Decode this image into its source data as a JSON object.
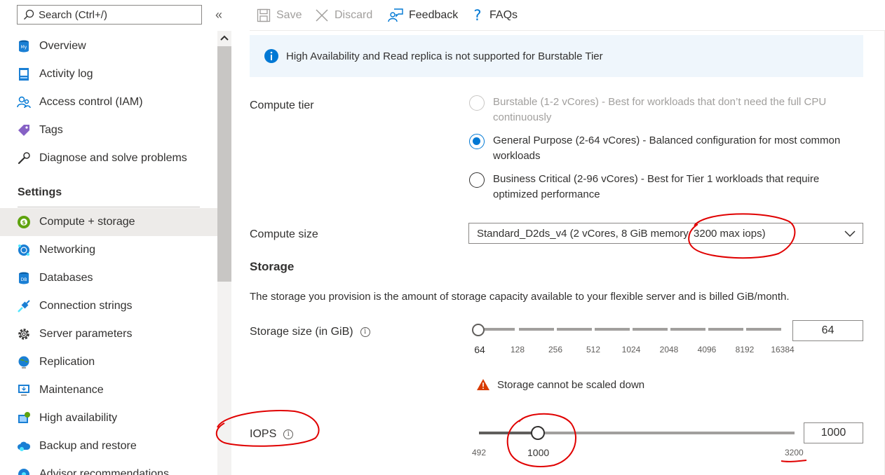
{
  "sidebar": {
    "search_placeholder": "Search (Ctrl+/)",
    "collapse_label": "«",
    "items_top": [
      {
        "label": "Overview",
        "icon": "mysql-database-icon"
      },
      {
        "label": "Activity log",
        "icon": "activity-log-icon"
      },
      {
        "label": "Access control (IAM)",
        "icon": "people-icon"
      },
      {
        "label": "Tags",
        "icon": "tag-icon"
      },
      {
        "label": "Diagnose and solve problems",
        "icon": "wrench-icon"
      }
    ],
    "settings_header": "Settings",
    "items_settings": [
      {
        "label": "Compute + storage",
        "icon": "compute-storage-icon"
      },
      {
        "label": "Networking",
        "icon": "network-globe-icon"
      },
      {
        "label": "Databases",
        "icon": "database-icon"
      },
      {
        "label": "Connection strings",
        "icon": "connection-plug-icon"
      },
      {
        "label": "Server parameters",
        "icon": "gear-icon"
      },
      {
        "label": "Replication",
        "icon": "replication-globe-icon"
      },
      {
        "label": "Maintenance",
        "icon": "maintenance-monitor-icon"
      },
      {
        "label": "High availability",
        "icon": "high-availability-icon"
      },
      {
        "label": "Backup and restore",
        "icon": "cloud-backup-icon"
      },
      {
        "label": "Advisor recommendations",
        "icon": "advisor-icon"
      }
    ]
  },
  "toolbar": {
    "save": "Save",
    "discard": "Discard",
    "feedback": "Feedback",
    "faqs": "FAQs"
  },
  "colors": {
    "accent": "#0078d4",
    "info_bg": "#eff6fc",
    "warning": "#d83b01",
    "annotation": "#e00000"
  },
  "main": {
    "info_banner": "High Availability and Read replica is not supported for Burstable Tier",
    "compute_tier": {
      "label": "Compute tier",
      "options": [
        {
          "text": "Burstable (1-2 vCores) - Best for workloads that don’t need the full CPU continuously",
          "state": "disabled"
        },
        {
          "text": "General Purpose (2-64 vCores) - Balanced configuration for most common workloads",
          "state": "selected"
        },
        {
          "text": "Business Critical (2-96 vCores) - Best for Tier 1 workloads that require optimized performance",
          "state": "unselected"
        }
      ]
    },
    "compute_size": {
      "label": "Compute size",
      "value": "Standard_D2ds_v4 (2 vCores, 8 GiB memory, 3200 max iops)"
    },
    "storage": {
      "heading": "Storage",
      "description": "The storage you provision is the amount of storage capacity available to your flexible server and is billed GiB/month.",
      "size_label": "Storage size (in GiB)",
      "size_value": "64",
      "size_fraction": 0,
      "ticks": [
        "64",
        "128",
        "256",
        "512",
        "1024",
        "2048",
        "4096",
        "8192",
        "16384"
      ],
      "warning": "Storage cannot be scaled down"
    },
    "iops": {
      "label": "IOPS",
      "min": "492",
      "current": "1000",
      "max": "3200",
      "input_value": "1000",
      "fraction": 0.188
    }
  }
}
